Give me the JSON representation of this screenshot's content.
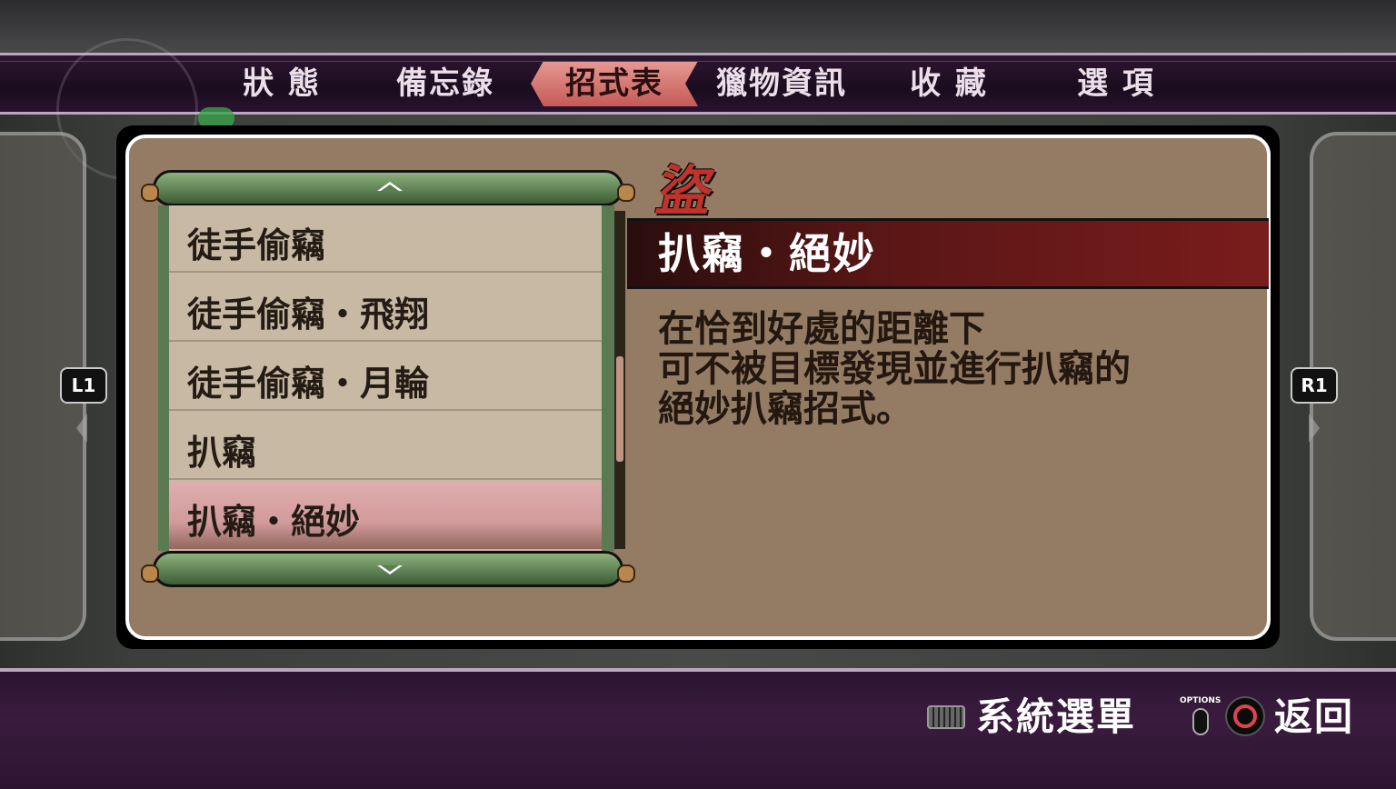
{
  "tabs": [
    {
      "label": "狀 態"
    },
    {
      "label": "備忘錄"
    },
    {
      "label": "招式表"
    },
    {
      "label": "獵物資訊"
    },
    {
      "label": "收 藏"
    },
    {
      "label": "選 項"
    }
  ],
  "active_tab_index": 2,
  "shoulder": {
    "left": "L1",
    "right": "R1"
  },
  "moves": [
    {
      "label": "徒手偷竊"
    },
    {
      "label": "徒手偷竊・飛翔"
    },
    {
      "label": "徒手偷竊・月輪"
    },
    {
      "label": "扒竊"
    },
    {
      "label": "扒竊・絕妙"
    }
  ],
  "selected_move_index": 4,
  "detail": {
    "category_glyph": "盜",
    "title": "扒竊・絕妙",
    "description_lines": [
      "在恰到好處的距離下",
      "可不被目標發現並進行扒竊的",
      "絕妙扒竊招式。"
    ]
  },
  "footer": {
    "system_menu_label": "系統選單",
    "options_label": "OPTIONS",
    "back_label": "返回"
  },
  "colors": {
    "accent_tab": "#c55a55",
    "panel": "#937b64",
    "title_band": "#7a1c1c",
    "bar": "#2b1430"
  }
}
